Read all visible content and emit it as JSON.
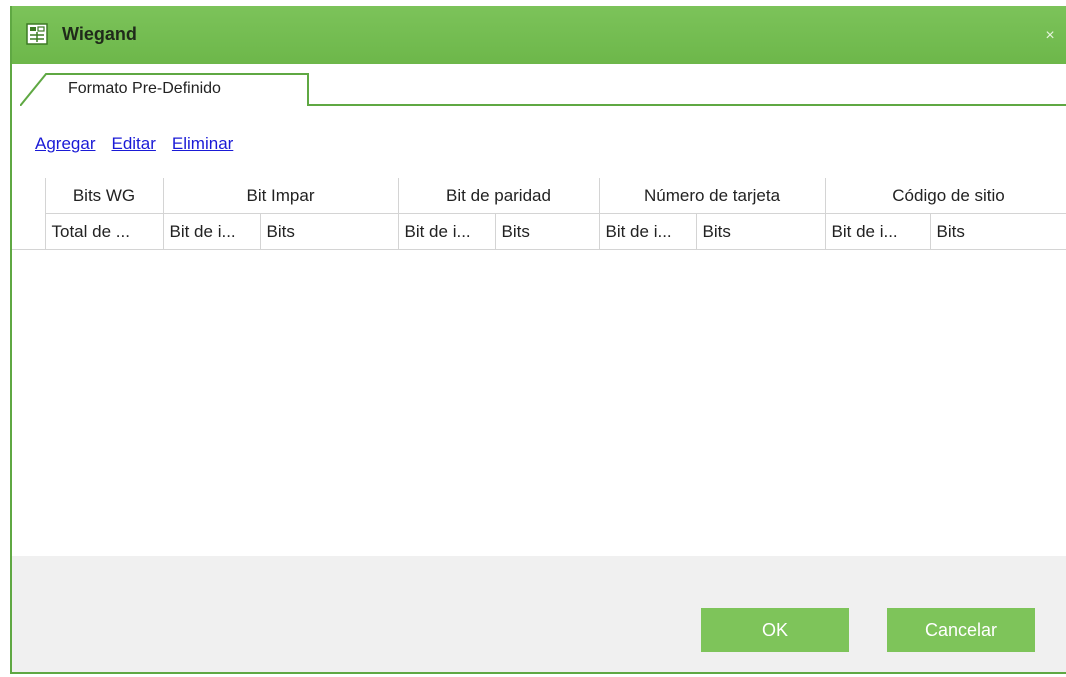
{
  "window": {
    "title": "Wiegand",
    "close_label": "×",
    "accent": "#6db74a"
  },
  "tabs": [
    {
      "label": "Formato Pre-Definido",
      "active": true
    }
  ],
  "actions": {
    "add": "Agregar",
    "edit": "Editar",
    "delete": "Eliminar"
  },
  "table": {
    "group_headers": [
      {
        "label": "Bits WG"
      },
      {
        "label": "Bit Impar"
      },
      {
        "label": "Bit de paridad"
      },
      {
        "label": "Número de tarjeta"
      },
      {
        "label": "Código de sitio"
      }
    ],
    "sub_headers": [
      "Total de ...",
      "Bit de i...",
      "Bits",
      "Bit de i...",
      "Bits",
      "Bit de i...",
      "Bits",
      "Bit de i...",
      "Bits"
    ],
    "rows": []
  },
  "buttons": {
    "ok": "OK",
    "cancel": "Cancelar"
  }
}
